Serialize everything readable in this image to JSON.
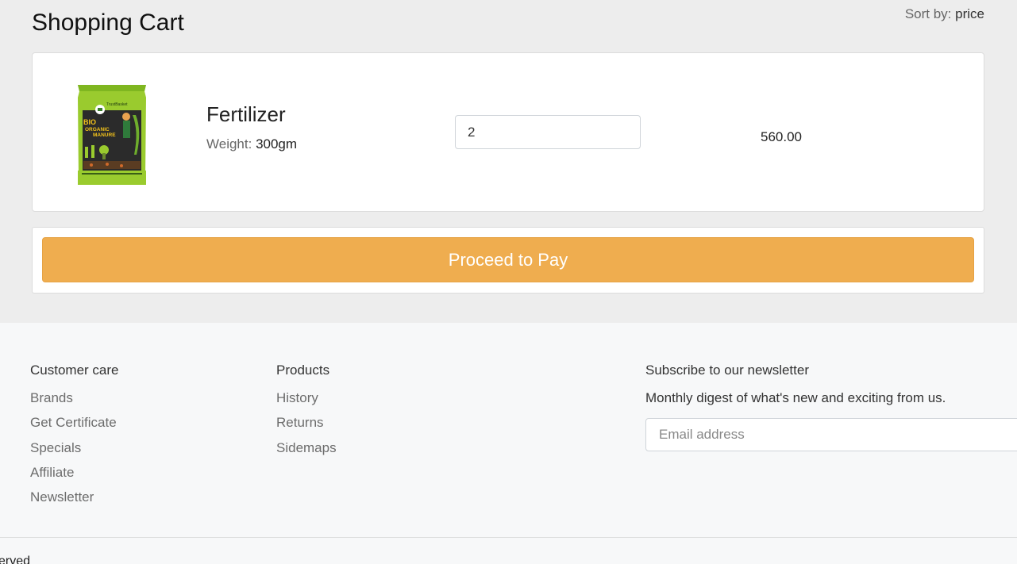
{
  "header": {
    "title": "Shopping Cart",
    "sort_label": "Sort by:",
    "sort_value": "price"
  },
  "cart": {
    "items": [
      {
        "name": "Fertilizer",
        "weight_label": "Weight:",
        "weight_value": "300gm",
        "quantity": "2",
        "price": "560.00",
        "image_icon": "fertilizer-bag-image",
        "package_text": {
          "brand": "TrustBasket",
          "line1": "BIO",
          "line2": "ORGANIC",
          "line3": "MANURE"
        }
      }
    ],
    "pay_button": "Proceed to Pay"
  },
  "footer": {
    "customer_care": {
      "title": "Customer care",
      "links": [
        "Brands",
        "Get Certificate",
        "Specials",
        "Affiliate",
        "Newsletter"
      ]
    },
    "products": {
      "title": "Products",
      "links": [
        "History",
        "Returns",
        "Sidemaps"
      ]
    },
    "newsletter": {
      "title": "Subscribe to our newsletter",
      "description": "Monthly digest of what's new and exciting from us.",
      "placeholder": "Email address"
    },
    "copyright": "erved"
  },
  "colors": {
    "accent": "#efad4f",
    "page_bg": "#ededed",
    "footer_bg": "#f7f8f9"
  }
}
